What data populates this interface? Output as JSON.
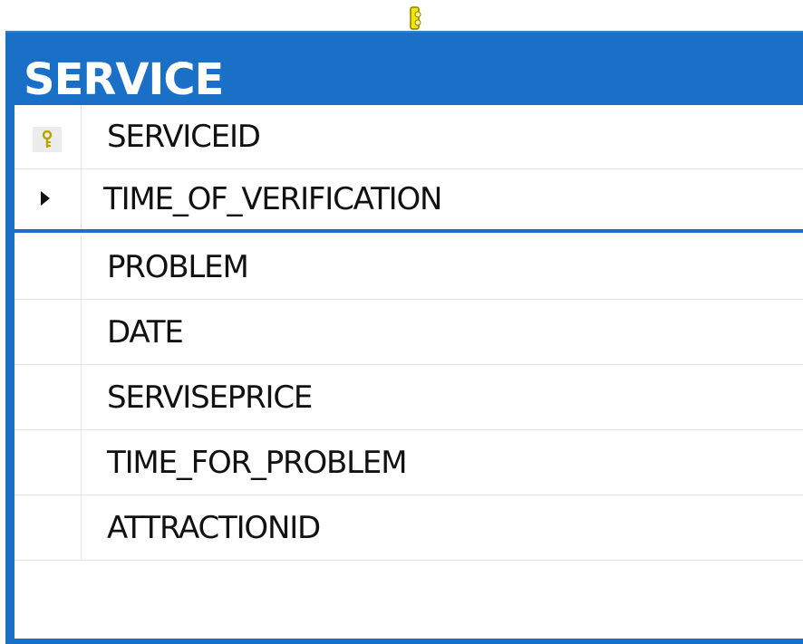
{
  "table": {
    "title": "SERVICE",
    "columns": [
      {
        "label": "SERVICEID",
        "is_primary_key": true,
        "is_current": false
      },
      {
        "label": "TIME_OF_VERIFICATION",
        "is_primary_key": false,
        "is_current": true
      },
      {
        "label": "PROBLEM",
        "is_primary_key": false,
        "is_current": false
      },
      {
        "label": "DATE",
        "is_primary_key": false,
        "is_current": false
      },
      {
        "label": "SERVISEPRICE",
        "is_primary_key": false,
        "is_current": false
      },
      {
        "label": "TIME_FOR_PROBLEM",
        "is_primary_key": false,
        "is_current": false
      },
      {
        "label": "ATTRACTIONID",
        "is_primary_key": false,
        "is_current": false
      }
    ]
  },
  "icons": {
    "primary_key": "key-icon",
    "current_row": "row-pointer-icon",
    "relationship": "relationship-connector-icon"
  },
  "colors": {
    "header": "#1a6fc6",
    "title_text": "#ffffff",
    "key": "#d8c400",
    "connector": "#f2e600"
  }
}
